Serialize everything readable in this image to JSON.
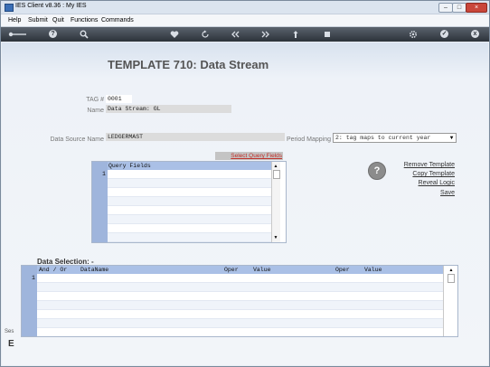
{
  "window": {
    "title": "IES Client v8.36 : My IES",
    "min_label": "–",
    "max_label": "□",
    "close_label": "×"
  },
  "menu": {
    "items": [
      "Help",
      "Submit",
      "Quit",
      "Functions",
      "Commands"
    ]
  },
  "toolbar": {
    "icons": [
      "back-arrow-icon",
      "help-icon",
      "search-icon",
      "heart-icon",
      "refresh-icon",
      "rewind-icon",
      "fast-forward-icon",
      "upload-icon",
      "stop-icon",
      "settings-icon",
      "check-icon",
      "close-icon"
    ],
    "help_glyph": "?",
    "check_glyph": "✓",
    "close_glyph": "x"
  },
  "page": {
    "title": "TEMPLATE 710: Data Stream"
  },
  "form": {
    "tag_label": "TAG #",
    "tag_value": "0001",
    "name_label": "Name",
    "name_value": "Data Stream: GL",
    "data_source_label": "Data Source Name",
    "data_source_value": "LEDGERMAST",
    "period_mapping_label": "Period Mapping",
    "period_mapping_value": "2: tag maps to current year"
  },
  "query": {
    "select_link": "Select Query Fields",
    "header": "Query Fields",
    "row_number": "1"
  },
  "actions": {
    "remove": "Remove Template",
    "copy": "Copy Template",
    "reveal": "Reveal Logic",
    "save": "Save",
    "help_glyph": "?"
  },
  "data_selection": {
    "label": "Data Selection: -",
    "columns": [
      "And / Or",
      "DataName",
      "Oper",
      "Value",
      "Oper",
      "Value"
    ],
    "row_number": "1"
  },
  "scroll": {
    "up": "▲",
    "down": "▼"
  },
  "sidebar": {
    "text1": "Ses",
    "text2": "E"
  }
}
